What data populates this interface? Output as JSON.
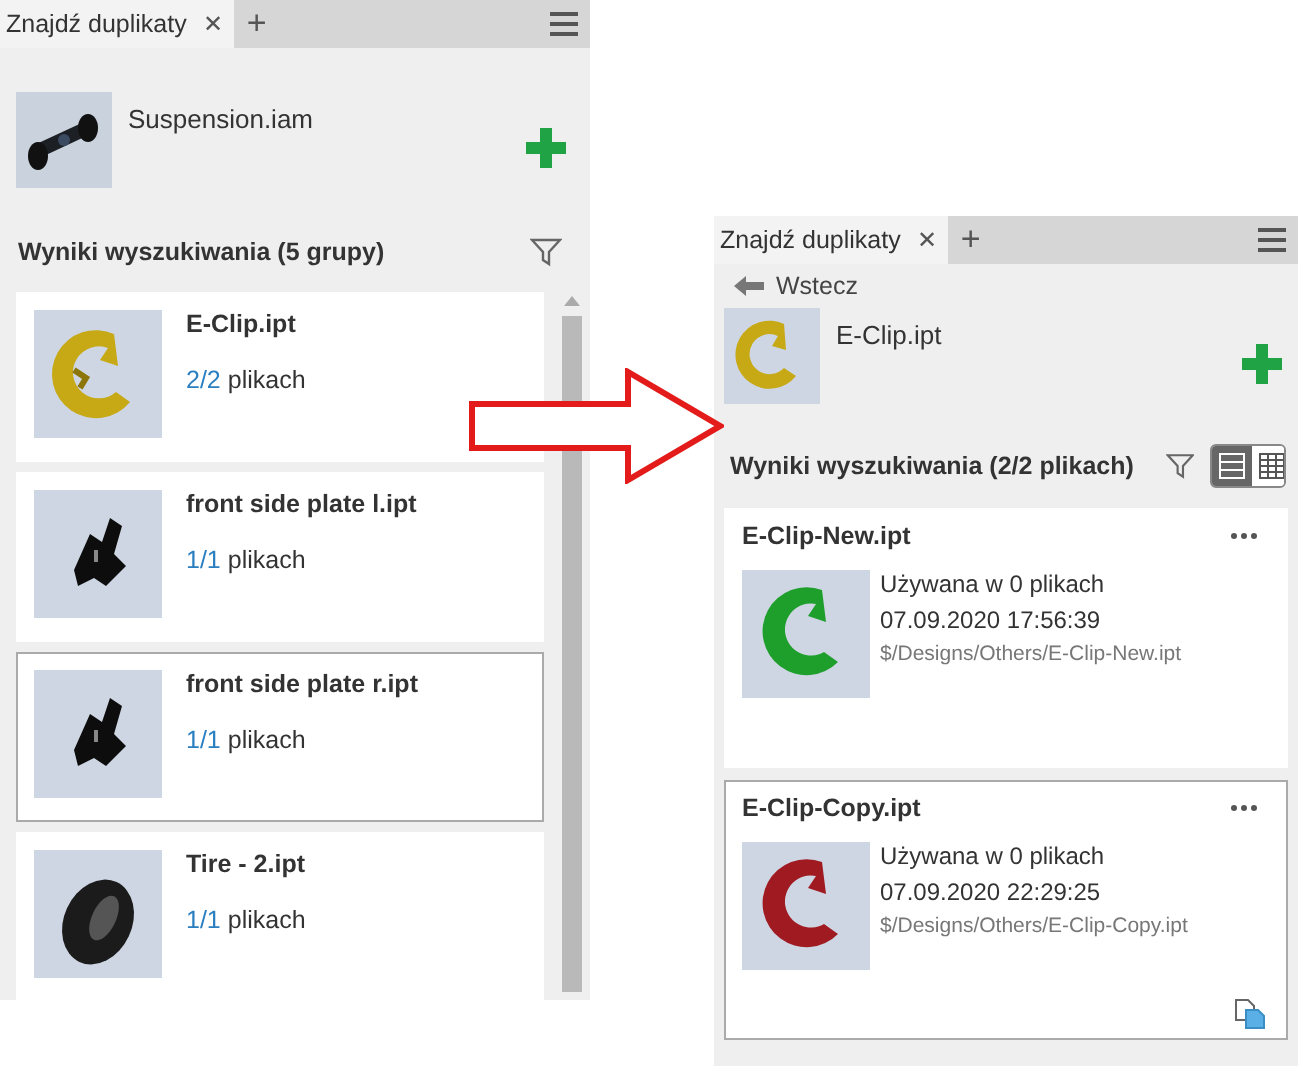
{
  "left_panel": {
    "tab": {
      "label": "Znajdź duplikaty",
      "close": "✕",
      "add": "+"
    },
    "source": {
      "name": "Suspension.iam"
    },
    "results_title": "Wyniki wyszukiwania (5 grupy)",
    "groups": [
      {
        "name": "E-Clip.ipt",
        "count": "2/2",
        "unit": "plikach",
        "selected": false
      },
      {
        "name": "front side plate l.ipt",
        "count": "1/1",
        "unit": "plikach",
        "selected": false
      },
      {
        "name": "front side plate r.ipt",
        "count": "1/1",
        "unit": "plikach",
        "selected": true
      },
      {
        "name": "Tire - 2.ipt",
        "count": "1/1",
        "unit": "plikach",
        "selected": false
      }
    ]
  },
  "right_panel": {
    "tab": {
      "label": "Znajdź duplikaty",
      "close": "✕",
      "add": "+"
    },
    "back": "Wstecz",
    "source": {
      "name": "E-Clip.ipt"
    },
    "results_title": "Wyniki wyszukiwania (2/2 plikach)",
    "view_modes": [
      {
        "kind": "list",
        "selected": true
      },
      {
        "kind": "grid",
        "selected": false
      }
    ],
    "files": [
      {
        "name": "E-Clip-New.ipt",
        "usage": "Używana w 0 plikach",
        "date": "07.09.2020 17:56:39",
        "path": "$/Designs/Others/E-Clip-New.ipt",
        "color": "#1e9e2a",
        "selected": false,
        "copy_icon": false
      },
      {
        "name": "E-Clip-Copy.ipt",
        "usage": "Używana w 0 plikach",
        "date": "07.09.2020 22:29:25",
        "path": "$/Designs/Others/E-Clip-Copy.ipt",
        "color": "#a01a22",
        "selected": true,
        "copy_icon": true
      }
    ]
  }
}
